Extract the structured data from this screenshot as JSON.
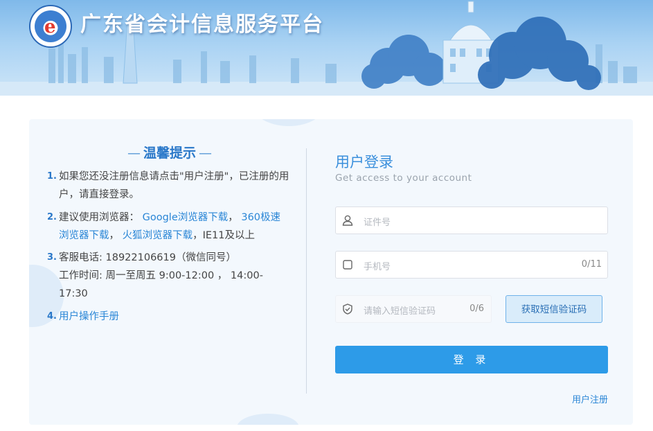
{
  "header": {
    "site_title": "广东省会计信息服务平台",
    "logo_mark": "e",
    "logo_icon": "platform-logo-icon"
  },
  "tips": {
    "title": "温馨提示",
    "title_dash": "—",
    "items": [
      {
        "num": "1.",
        "text": "如果您还没注册信息请点击\"用户注册\"，已注册的用户，请直接登录。"
      },
      {
        "num": "2.",
        "prefix": "建议使用浏览器：",
        "link_google": "Google浏览器下载",
        "sep1": "，",
        "link_360": "360极速浏览器下载",
        "sep2": "，",
        "link_firefox": "火狐浏览器下载",
        "suffix": "，IE11及以上"
      },
      {
        "num": "3.",
        "phone": "客服电话: 18922106619（微信同号）",
        "hours": "工作时间: 周一至周五 9:00-12:00 ， 14:00-17:30"
      },
      {
        "num": "4.",
        "link_manual": "用户操作手册"
      }
    ]
  },
  "login": {
    "title": "用户登录",
    "subtitle": "Get access to your account",
    "id_placeholder": "证件号",
    "id_icon": "user-icon",
    "phone_placeholder": "手机号",
    "phone_icon": "phone-icon",
    "phone_count": "0/11",
    "sms_placeholder": "请输入短信验证码",
    "sms_icon": "shield-icon",
    "sms_count": "0/6",
    "sms_button": "获取短信验证码",
    "login_button": "登 录",
    "register_link": "用户注册"
  },
  "colors": {
    "accent": "#2d9be8",
    "link": "#2a86d6",
    "panel_bg": "#f3f8fd",
    "banner_top": "#7fb9ea"
  }
}
